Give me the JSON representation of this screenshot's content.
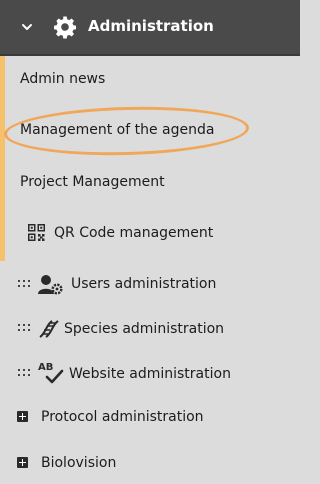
{
  "header": {
    "title": "Administration",
    "chevron_icon": "chevron-down-icon",
    "section_icon": "gear-icon",
    "background": "#4a4a4a"
  },
  "agenda_submenu": {
    "accent_color": "#f5c26b",
    "highlight_color": "#f0a75a",
    "items": [
      {
        "label": "Admin news"
      },
      {
        "label": "Management of the agenda",
        "highlighted": true
      },
      {
        "label": "Project Management"
      },
      {
        "label": "QR Code management",
        "icon": "qr-code-icon"
      }
    ]
  },
  "menu": {
    "items": [
      {
        "label": "Users administration",
        "icon": "users-gear-icon",
        "handle": "drag-handle-icon"
      },
      {
        "label": "Species administration",
        "icon": "dna-icon",
        "handle": "drag-handle-icon"
      },
      {
        "label": "Website administration",
        "icon": "spellcheck-icon",
        "handle": "drag-handle-icon"
      },
      {
        "label": "Protocol administration",
        "icon": "plus-square-icon"
      },
      {
        "label": "Biolovision",
        "icon": "plus-square-icon"
      }
    ]
  }
}
